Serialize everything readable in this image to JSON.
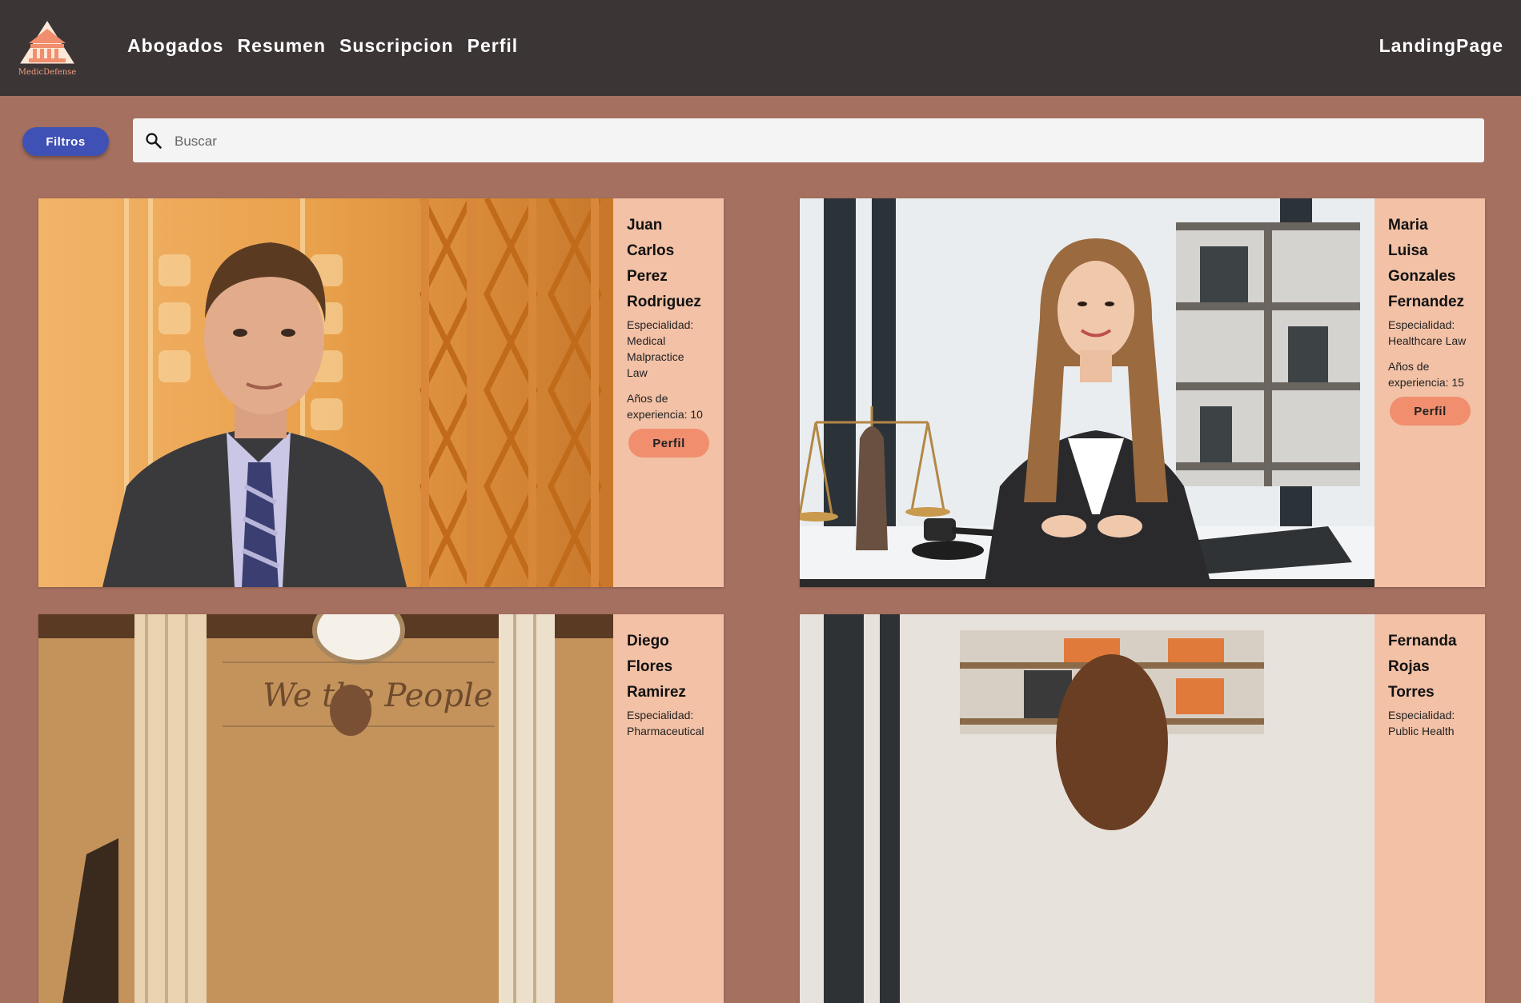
{
  "brand": {
    "name": "MedicDefense"
  },
  "nav": {
    "items": [
      "Abogados",
      "Resumen",
      "Suscripcion",
      "Perfil"
    ],
    "landing": "LandingPage"
  },
  "toolbar": {
    "filter_label": "Filtros",
    "search_placeholder": "Buscar",
    "search_value": ""
  },
  "lawyers": [
    {
      "name_lines": [
        "Juan",
        "Carlos",
        "Perez",
        "Rodriguez"
      ],
      "specialty_lines": [
        "Especialidad:",
        "Medical",
        "Malpractice",
        "Law"
      ],
      "years_lines": [
        "Años de",
        "experiencia: 10"
      ],
      "button": "Perfil"
    },
    {
      "name_lines": [
        "Maria",
        "Luisa",
        "Gonzales",
        "Fernandez"
      ],
      "specialty_lines": [
        "Especialidad:",
        "Healthcare Law"
      ],
      "years_lines": [
        "Años de",
        "experiencia: 15"
      ],
      "button": "Perfil"
    },
    {
      "name_lines": [
        "Diego",
        "Flores",
        "Ramirez"
      ],
      "specialty_lines": [
        "Especialidad:",
        "Pharmaceutical"
      ],
      "years_lines": [],
      "button": ""
    },
    {
      "name_lines": [
        "Fernanda",
        "Rojas",
        "Torres"
      ],
      "specialty_lines": [
        "Especialidad:",
        "Public Health"
      ],
      "years_lines": [],
      "button": ""
    }
  ],
  "photo_texts": {
    "constitution": "We the People"
  },
  "colors": {
    "topbar": "#3b3536",
    "page_background": "#a57060",
    "card_info": "#f2c1a6",
    "profile_button": "#f08e6e",
    "filter_button": "#3f51b5"
  }
}
